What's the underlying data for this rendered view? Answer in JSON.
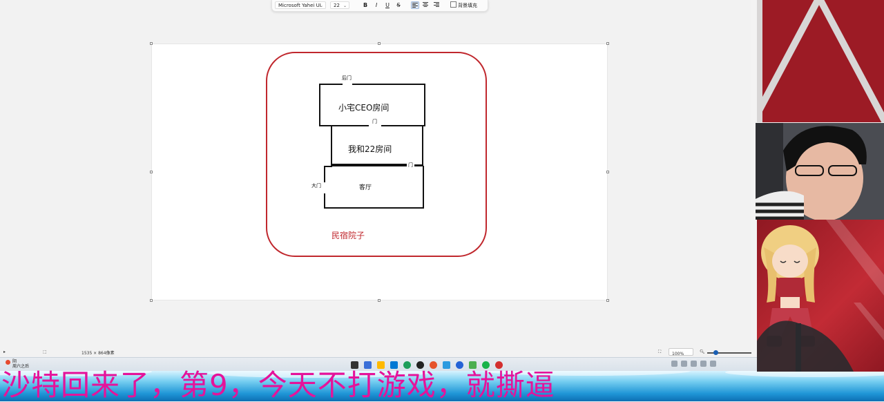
{
  "toolbar": {
    "font_name": "Microsoft Yahei UI",
    "font_size": "22",
    "bold": "B",
    "italic": "I",
    "underline": "U",
    "strike": "S",
    "fill_label": "背景填充"
  },
  "diagram": {
    "back_door": "后门",
    "room1": "小宅CEO房间",
    "door1": "门",
    "room2": "我和22房间",
    "door2": "门",
    "front_door": "大门",
    "room3": "客厅",
    "yard": "民宿院子"
  },
  "status": {
    "size_text": "1535 × 864像素",
    "zoom": "100%"
  },
  "taskbar": {
    "weather_title": "阴",
    "weather_sub": "周六之后"
  },
  "subtitle": "沙特回来了，第9，今天不打游戏，就撕逼",
  "colors": {
    "accent_red": "#c0272d",
    "subtitle_pink": "#e5139a",
    "stream_red": "#9c1b25"
  }
}
